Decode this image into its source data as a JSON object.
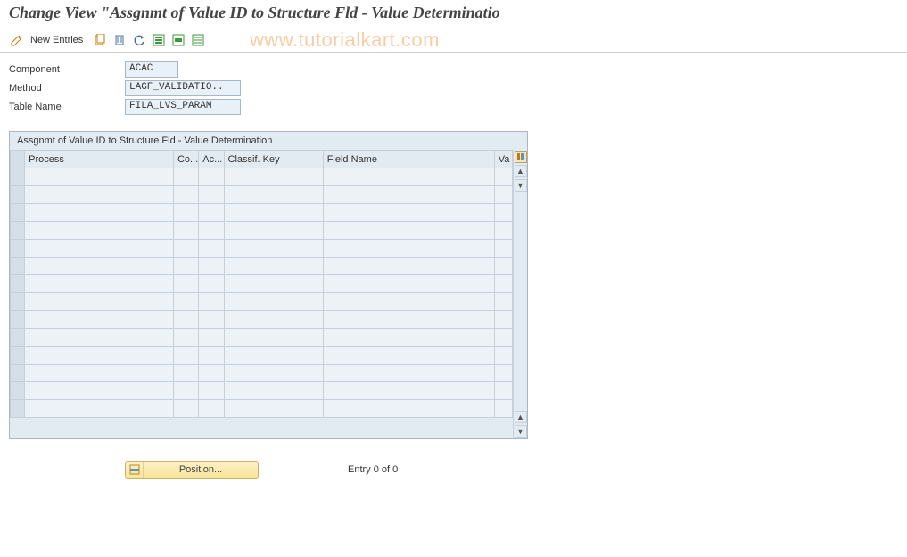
{
  "title": "Change View \"Assgnmt of Value ID to Structure Fld - Value Determinatio",
  "watermark": "www.tutorialkart.com",
  "toolbar": {
    "new_entries": "New Entries"
  },
  "form": {
    "component_label": "Component",
    "component_value": "ACAC",
    "method_label": "Method",
    "method_value": "LAGF_VALIDATIO..",
    "tablename_label": "Table Name",
    "tablename_value": "FILA_LVS_PARAM"
  },
  "table_title": "Assgnmt of Value ID to Structure Fld - Value Determination",
  "columns": {
    "process": "Process",
    "co": "Co...",
    "ac": "Ac...",
    "classif": "Classif. Key",
    "field": "Field Name",
    "va": "Va"
  },
  "footer": {
    "position_label": "Position...",
    "entry_text": "Entry 0 of 0"
  },
  "row_count": 14
}
